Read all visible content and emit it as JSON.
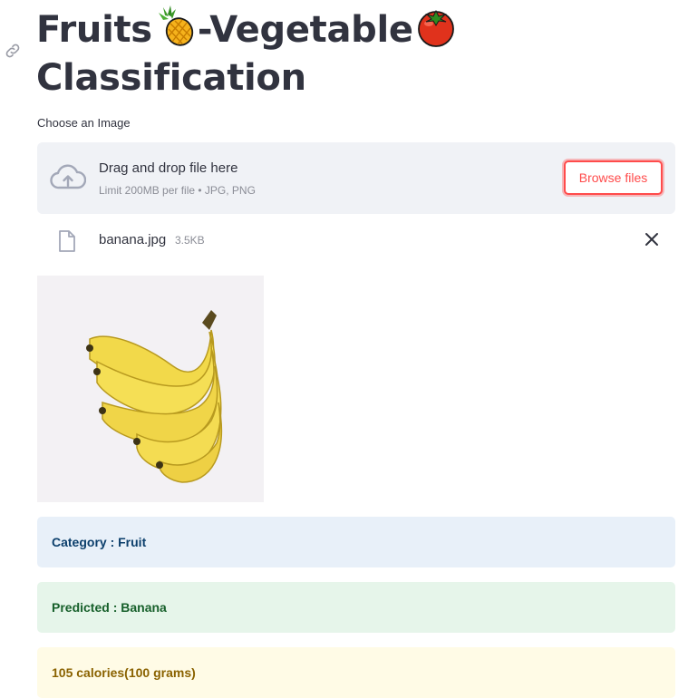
{
  "page": {
    "title_parts": {
      "word1": "Fruits",
      "word2": "-Vegetable",
      "line2": "Classification"
    },
    "title_icons": [
      "pineapple-icon",
      "tomato-icon"
    ]
  },
  "uploader": {
    "label": "Choose an Image",
    "dropzone_title": "Drag and drop file here",
    "dropzone_limit": "Limit 200MB per file • JPG, PNG",
    "browse_label": "Browse files",
    "file": {
      "name": "banana.jpg",
      "size": "3.5KB"
    }
  },
  "results": {
    "category": "Category : Fruit",
    "predicted": "Predicted : Banana",
    "calories": "105 calories(100 grams)"
  },
  "colors": {
    "accent": "#ff4b4b",
    "text": "#31333f",
    "info_bg": "#e8f0f9",
    "success_bg": "#e6f5ea",
    "warning_bg": "#fffbe6"
  }
}
